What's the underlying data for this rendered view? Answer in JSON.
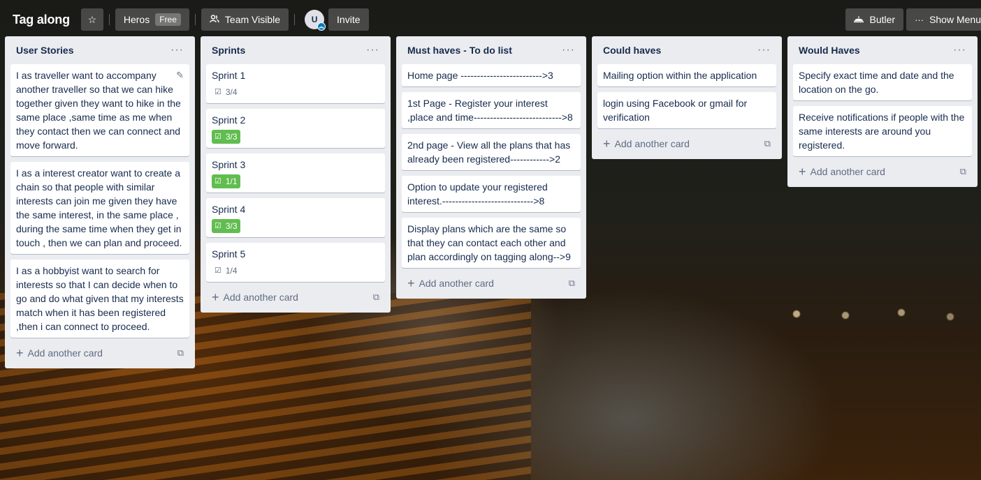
{
  "board": {
    "title": "Tag along",
    "workspace": "Heros",
    "plan_badge": "Free",
    "visibility": "Team Visible",
    "avatar_initial": "U",
    "invite_label": "Invite",
    "butler_label": "Butler",
    "show_menu_label": "Show Menu"
  },
  "add_card_label": "Add another card",
  "lists": [
    {
      "title": "User Stories",
      "cards": [
        "I as traveller want to accompany another traveller so that we can hike together given they want to hike in the same place ,same time as me when they contact then we can connect and move forward.",
        "I as a interest creator want to create a chain so that people with similar interests can join me given they have the same interest, in the same place , during the same time when they get in touch , then we can plan and proceed.",
        "I as a hobbyist want to search for interests so that I can decide when to go and do what given that my interests match when it has been registered ,then i can connect to proceed."
      ]
    },
    {
      "title": "Sprints",
      "cards": [
        {
          "title": "Sprint 1",
          "checklist": "3/4",
          "complete": false
        },
        {
          "title": "Sprint 2",
          "checklist": "3/3",
          "complete": true
        },
        {
          "title": "Sprint 3",
          "checklist": "1/1",
          "complete": true
        },
        {
          "title": "Sprint 4",
          "checklist": "3/3",
          "complete": true
        },
        {
          "title": "Sprint 5",
          "checklist": "1/4",
          "complete": false
        }
      ]
    },
    {
      "title": "Must haves - To do list",
      "cards": [
        "Home page ------------------------->3",
        "1st Page - Register your interest ,place and time--------------------------->8",
        "2nd page - View all the plans that has already been registered------------>2",
        "Option to update your registered interest.---------------------------->8",
        "Display plans which are the same so that they can contact each other and plan accordingly on tagging along-->9"
      ]
    },
    {
      "title": "Could haves",
      "cards": [
        "Mailing option within the application",
        "login using Facebook or gmail for verification"
      ]
    },
    {
      "title": "Would Haves",
      "cards": [
        "Specify exact time and date and the location on the go.",
        "Receive notifications if people with the same interests are around you registered."
      ]
    }
  ],
  "colors": {
    "list_bg": "#ebecf0",
    "badge_complete": "#61bd4f",
    "text": "#172b4d"
  }
}
